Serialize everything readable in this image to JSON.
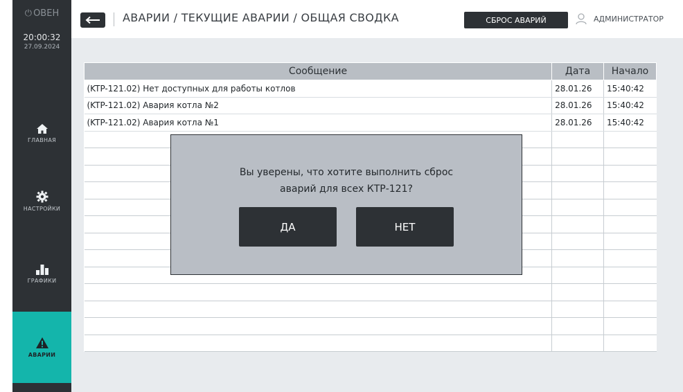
{
  "sidebar": {
    "brand": "ОВЕН",
    "time": "20:00:32",
    "date": "27.09.2024",
    "items": [
      {
        "label": "ГЛАВНАЯ",
        "icon": "home-icon"
      },
      {
        "label": "НАСТРОЙКИ",
        "icon": "gear-icon"
      },
      {
        "label": "ГРАФИКИ",
        "icon": "bar-chart-icon"
      },
      {
        "label": "АВАРИИ",
        "icon": "warning-icon",
        "active": true
      }
    ]
  },
  "header": {
    "back_icon": "arrow-left-icon",
    "breadcrumb": "АВАРИИ / ТЕКУЩИЕ АВАРИИ / ОБЩАЯ СВОДКА",
    "reset_label": "СБРОС АВАРИЙ",
    "user_icon": "user-icon",
    "user_name": "АДМИНИСТРАТОР"
  },
  "table": {
    "columns": [
      "Сообщение",
      "Дата",
      "Начало"
    ],
    "rows": [
      {
        "message": "(KTP-121.02) Нет доступных для работы котлов",
        "date": "28.01.26",
        "start": "15:40:42"
      },
      {
        "message": "(KTP-121.02) Авария котла №2",
        "date": "28.01.26",
        "start": "15:40:42"
      },
      {
        "message": "(KTP-121.02) Авария котла №1",
        "date": "28.01.26",
        "start": "15:40:42"
      }
    ]
  },
  "dialog": {
    "line1": "Вы уверены, что хотите выполнить сброс",
    "line2": "аварий для всех КТР-121?",
    "yes_label": "ДА",
    "no_label": "НЕТ"
  },
  "colors": {
    "sidebar_bg": "#2d3135",
    "accent": "#14b5ab",
    "content_bg": "#e8ebee",
    "header_cell_bg": "#b9bec4",
    "dialog_bg": "#b9bec5"
  }
}
